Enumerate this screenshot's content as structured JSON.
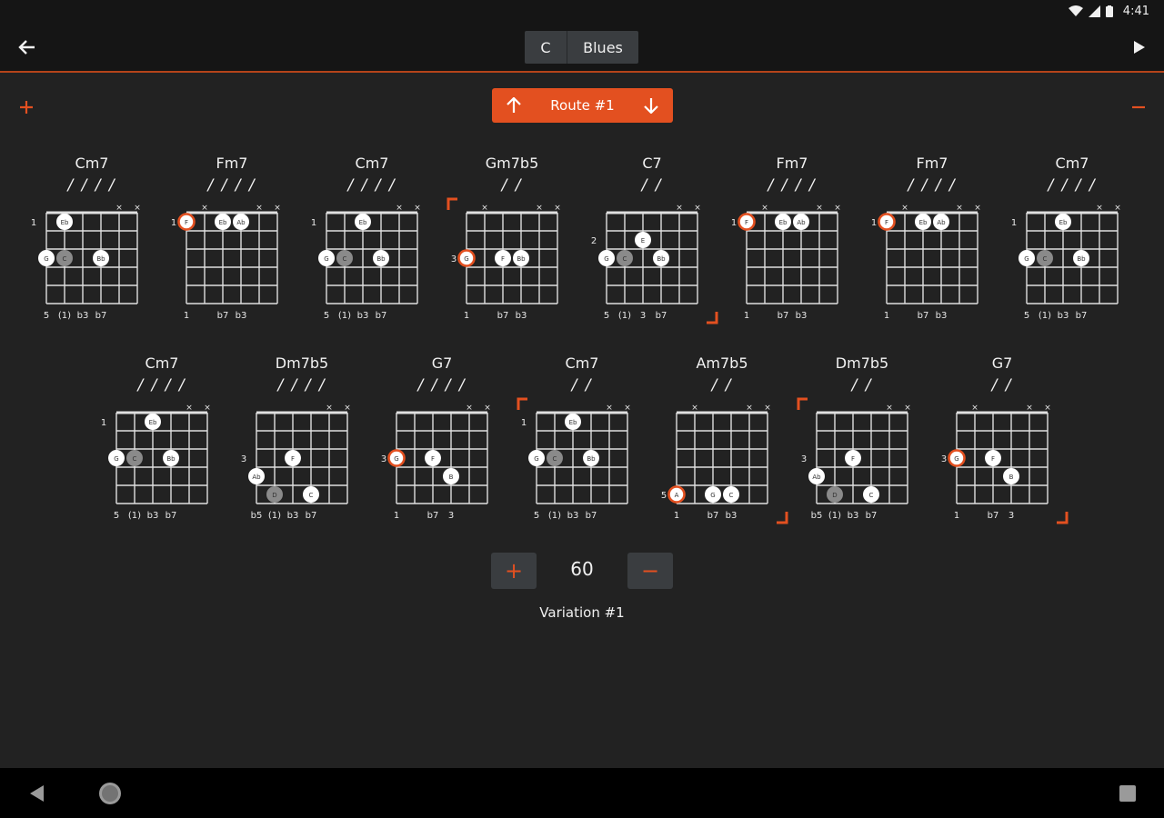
{
  "status": {
    "time": "4:41"
  },
  "header": {
    "key": "C",
    "scale": "Blues"
  },
  "route": {
    "label": "Route #1"
  },
  "rows": [
    [
      {
        "name": "Cm7",
        "beats": "/ / / /",
        "fret": "1",
        "fretRow": 1,
        "muted": [
          4,
          5
        ],
        "dots": [
          {
            "s": 1,
            "r": 1,
            "t": "Eb"
          },
          {
            "s": 0,
            "r": 3,
            "t": "G"
          },
          {
            "s": 1,
            "r": 3,
            "t": "C",
            "g": 1
          },
          {
            "s": 3,
            "r": 3,
            "t": "Bb"
          }
        ],
        "labels": [
          "5",
          "(1)",
          "b3",
          "b7"
        ],
        "labelPos": [
          0,
          1,
          2,
          3
        ],
        "bracket": ""
      },
      {
        "name": "Fm7",
        "beats": "/ / / /",
        "fret": "1",
        "fretRow": 1,
        "muted": [
          1,
          4,
          5
        ],
        "dots": [
          {
            "s": 0,
            "r": 1,
            "t": "F",
            "rt": 1
          },
          {
            "s": 2,
            "r": 1,
            "t": "Eb"
          },
          {
            "s": 3,
            "r": 1,
            "t": "Ab"
          }
        ],
        "labels": [
          "1",
          "b7",
          "b3"
        ],
        "labelPos": [
          0,
          2,
          3
        ],
        "bracket": ""
      },
      {
        "name": "Cm7",
        "beats": "/ / / /",
        "fret": "1",
        "fretRow": 1,
        "muted": [
          4,
          5
        ],
        "dots": [
          {
            "s": 2,
            "r": 1,
            "t": "Eb"
          },
          {
            "s": 0,
            "r": 3,
            "t": "G"
          },
          {
            "s": 1,
            "r": 3,
            "t": "C",
            "g": 1
          },
          {
            "s": 3,
            "r": 3,
            "t": "Bb"
          }
        ],
        "labels": [
          "5",
          "(1)",
          "b3",
          "b7"
        ],
        "labelPos": [
          0,
          1,
          2,
          3
        ],
        "bracket": ""
      },
      {
        "name": "Gm7b5",
        "beats": "/ /",
        "fret": "3",
        "fretRow": 3,
        "muted": [
          1,
          4,
          5
        ],
        "dots": [
          {
            "s": 0,
            "r": 3,
            "t": "G",
            "rt": 1
          },
          {
            "s": 2,
            "r": 3,
            "t": "F"
          },
          {
            "s": 3,
            "r": 3,
            "t": "Bb"
          }
        ],
        "labels": [
          "1",
          "b7",
          "b3"
        ],
        "labelPos": [
          0,
          2,
          3
        ],
        "bracket": "open"
      },
      {
        "name": "C7",
        "beats": "/ /",
        "fret": "2",
        "fretRow": 2,
        "muted": [
          4,
          5
        ],
        "dots": [
          {
            "s": 2,
            "r": 2,
            "t": "E"
          },
          {
            "s": 0,
            "r": 3,
            "t": "G"
          },
          {
            "s": 1,
            "r": 3,
            "t": "C",
            "g": 1
          },
          {
            "s": 3,
            "r": 3,
            "t": "Bb"
          }
        ],
        "labels": [
          "5",
          "(1)",
          "3",
          "b7"
        ],
        "labelPos": [
          0,
          1,
          2,
          3
        ],
        "bracket": "close"
      },
      {
        "name": "Fm7",
        "beats": "/ / / /",
        "fret": "1",
        "fretRow": 1,
        "muted": [
          1,
          4,
          5
        ],
        "dots": [
          {
            "s": 0,
            "r": 1,
            "t": "F",
            "rt": 1
          },
          {
            "s": 2,
            "r": 1,
            "t": "Eb"
          },
          {
            "s": 3,
            "r": 1,
            "t": "Ab"
          }
        ],
        "labels": [
          "1",
          "b7",
          "b3"
        ],
        "labelPos": [
          0,
          2,
          3
        ],
        "bracket": ""
      },
      {
        "name": "Fm7",
        "beats": "/ / / /",
        "fret": "1",
        "fretRow": 1,
        "muted": [
          1,
          4,
          5
        ],
        "dots": [
          {
            "s": 0,
            "r": 1,
            "t": "F",
            "rt": 1
          },
          {
            "s": 2,
            "r": 1,
            "t": "Eb"
          },
          {
            "s": 3,
            "r": 1,
            "t": "Ab"
          }
        ],
        "labels": [
          "1",
          "b7",
          "b3"
        ],
        "labelPos": [
          0,
          2,
          3
        ],
        "bracket": ""
      },
      {
        "name": "Cm7",
        "beats": "/ / / /",
        "fret": "1",
        "fretRow": 1,
        "muted": [
          4,
          5
        ],
        "dots": [
          {
            "s": 2,
            "r": 1,
            "t": "Eb"
          },
          {
            "s": 0,
            "r": 3,
            "t": "G"
          },
          {
            "s": 1,
            "r": 3,
            "t": "C",
            "g": 1
          },
          {
            "s": 3,
            "r": 3,
            "t": "Bb"
          }
        ],
        "labels": [
          "5",
          "(1)",
          "b3",
          "b7"
        ],
        "labelPos": [
          0,
          1,
          2,
          3
        ],
        "bracket": ""
      }
    ],
    [
      {
        "name": "Cm7",
        "beats": "/ / / /",
        "fret": "1",
        "fretRow": 1,
        "muted": [
          4,
          5
        ],
        "dots": [
          {
            "s": 2,
            "r": 1,
            "t": "Eb"
          },
          {
            "s": 0,
            "r": 3,
            "t": "G"
          },
          {
            "s": 1,
            "r": 3,
            "t": "C",
            "g": 1
          },
          {
            "s": 3,
            "r": 3,
            "t": "Bb"
          }
        ],
        "labels": [
          "5",
          "(1)",
          "b3",
          "b7"
        ],
        "labelPos": [
          0,
          1,
          2,
          3
        ],
        "bracket": ""
      },
      {
        "name": "Dm7b5",
        "beats": "/ / / /",
        "fret": "3",
        "fretRow": 3,
        "muted": [
          4,
          5
        ],
        "dots": [
          {
            "s": 2,
            "r": 3,
            "t": "F"
          },
          {
            "s": 0,
            "r": 4,
            "t": "Ab"
          },
          {
            "s": 1,
            "r": 5,
            "t": "D",
            "g": 1
          },
          {
            "s": 3,
            "r": 5,
            "t": "C"
          }
        ],
        "labels": [
          "b5",
          "(1)",
          "b3",
          "b7"
        ],
        "labelPos": [
          0,
          1,
          2,
          3
        ],
        "bracket": ""
      },
      {
        "name": "G7",
        "beats": "/ / / /",
        "fret": "3",
        "fretRow": 3,
        "muted": [
          4,
          5
        ],
        "dots": [
          {
            "s": 0,
            "r": 3,
            "t": "G",
            "rt": 1
          },
          {
            "s": 2,
            "r": 3,
            "t": "F"
          },
          {
            "s": 3,
            "r": 4,
            "t": "B"
          }
        ],
        "labels": [
          "1",
          "b7",
          "3"
        ],
        "labelPos": [
          0,
          2,
          3
        ],
        "bracket": ""
      },
      {
        "name": "Cm7",
        "beats": "/ /",
        "fret": "1",
        "fretRow": 1,
        "muted": [
          4,
          5
        ],
        "dots": [
          {
            "s": 2,
            "r": 1,
            "t": "Eb"
          },
          {
            "s": 0,
            "r": 3,
            "t": "G"
          },
          {
            "s": 1,
            "r": 3,
            "t": "C",
            "g": 1
          },
          {
            "s": 3,
            "r": 3,
            "t": "Bb"
          }
        ],
        "labels": [
          "5",
          "(1)",
          "b3",
          "b7"
        ],
        "labelPos": [
          0,
          1,
          2,
          3
        ],
        "bracket": "open"
      },
      {
        "name": "Am7b5",
        "beats": "/ /",
        "fret": "5",
        "fretRow": 5,
        "muted": [
          1,
          4,
          5
        ],
        "dots": [
          {
            "s": 0,
            "r": 5,
            "t": "A",
            "rt": 1
          },
          {
            "s": 2,
            "r": 5,
            "t": "G"
          },
          {
            "s": 3,
            "r": 5,
            "t": "C"
          }
        ],
        "labels": [
          "1",
          "b7",
          "b3"
        ],
        "labelPos": [
          0,
          2,
          3
        ],
        "bracket": "close"
      },
      {
        "name": "Dm7b5",
        "beats": "/ /",
        "fret": "3",
        "fretRow": 3,
        "muted": [
          4,
          5
        ],
        "dots": [
          {
            "s": 2,
            "r": 3,
            "t": "F"
          },
          {
            "s": 0,
            "r": 4,
            "t": "Ab"
          },
          {
            "s": 1,
            "r": 5,
            "t": "D",
            "g": 1
          },
          {
            "s": 3,
            "r": 5,
            "t": "C"
          }
        ],
        "labels": [
          "b5",
          "(1)",
          "b3",
          "b7"
        ],
        "labelPos": [
          0,
          1,
          2,
          3
        ],
        "bracket": "open"
      },
      {
        "name": "G7",
        "beats": "/ /",
        "fret": "3",
        "fretRow": 3,
        "muted": [
          1,
          4,
          5
        ],
        "dots": [
          {
            "s": 0,
            "r": 3,
            "t": "G",
            "rt": 1
          },
          {
            "s": 2,
            "r": 3,
            "t": "F"
          },
          {
            "s": 3,
            "r": 4,
            "t": "B"
          }
        ],
        "labels": [
          "1",
          "b7",
          "3"
        ],
        "labelPos": [
          0,
          2,
          3
        ],
        "bracket": "close"
      }
    ]
  ],
  "tempo": {
    "value": "60",
    "plus": "+",
    "minus": "−"
  },
  "variation": {
    "label": "Variation #1"
  },
  "colors": {
    "accent": "#e35020",
    "background": "#222222",
    "bar": "#151515",
    "button": "#3a3d40"
  }
}
